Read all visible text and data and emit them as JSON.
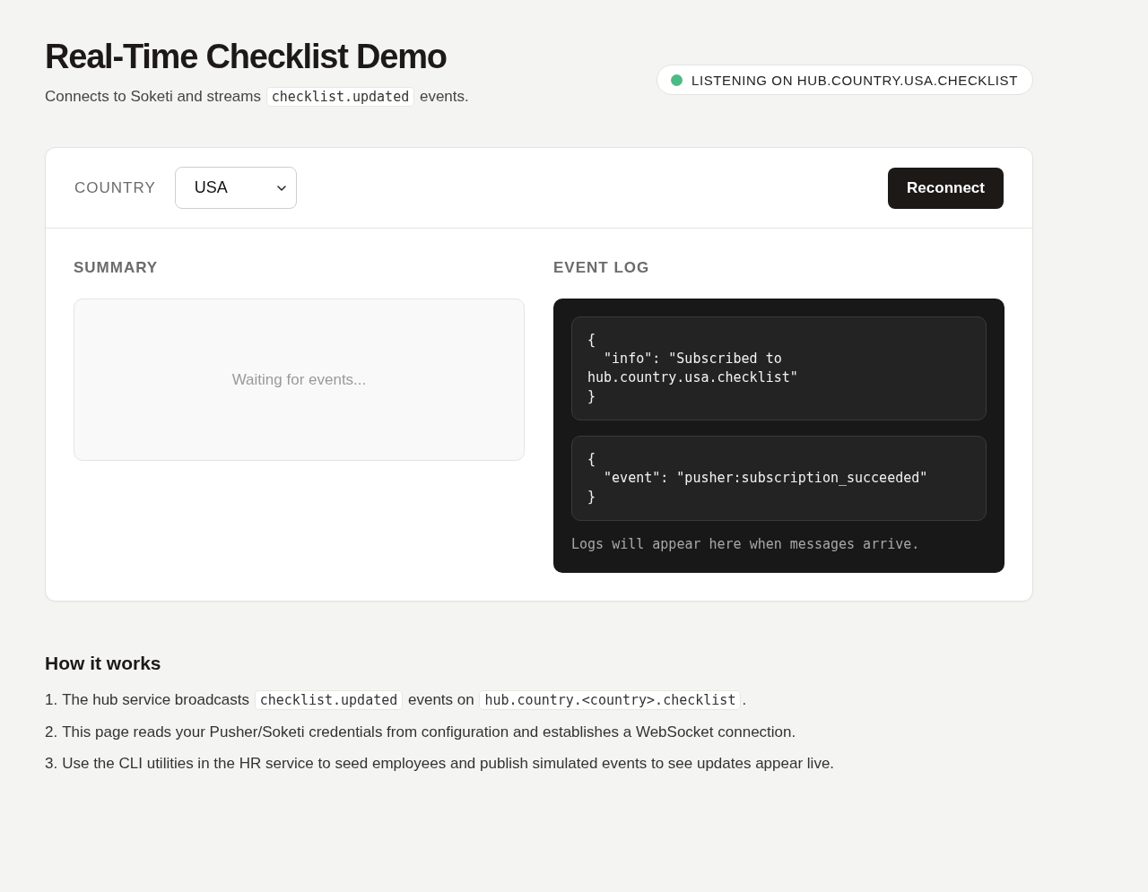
{
  "header": {
    "title": "Real-Time Checklist Demo",
    "subtitle": [
      {
        "kind": "text",
        "text": "Connects to Soketi and streams "
      },
      {
        "kind": "code",
        "text": "checklist.updated"
      },
      {
        "kind": "text",
        "text": " events."
      }
    ]
  },
  "status": {
    "connected": true,
    "label": "LISTENING ON HUB.COUNTRY.USA.CHECKLIST"
  },
  "toolbar": {
    "country_label": "COUNTRY",
    "country_select": {
      "value": "USA"
    },
    "reconnect_button": "Reconnect"
  },
  "summary": {
    "heading": "SUMMARY",
    "empty_text": "Waiting for events..."
  },
  "event_log": {
    "heading": "EVENT LOG",
    "entries": [
      {
        "text": "{\n  \"info\": \"Subscribed to\nhub.country.usa.checklist\"\n}"
      },
      {
        "text": "{\n  \"event\": \"pusher:subscription_succeeded\"\n}"
      }
    ],
    "footer": "Logs will appear here when messages arrive."
  },
  "how_it_works": {
    "heading": "How it works",
    "steps": [
      {
        "number": "1.",
        "parts": [
          {
            "kind": "text",
            "text": "The hub service broadcasts "
          },
          {
            "kind": "code",
            "text": "checklist.updated"
          },
          {
            "kind": "text",
            "text": " events on "
          },
          {
            "kind": "code",
            "text": "hub.country.<country>.checklist"
          },
          {
            "kind": "text",
            "text": "."
          }
        ]
      },
      {
        "number": "2.",
        "parts": [
          {
            "kind": "text",
            "text": "This page reads your Pusher/Soketi credentials from configuration and establishes a WebSocket connection."
          }
        ]
      },
      {
        "number": "3.",
        "parts": [
          {
            "kind": "text",
            "text": "Use the CLI utilities in the HR service to seed employees and publish simulated events to see updates appear live."
          }
        ]
      }
    ]
  }
}
